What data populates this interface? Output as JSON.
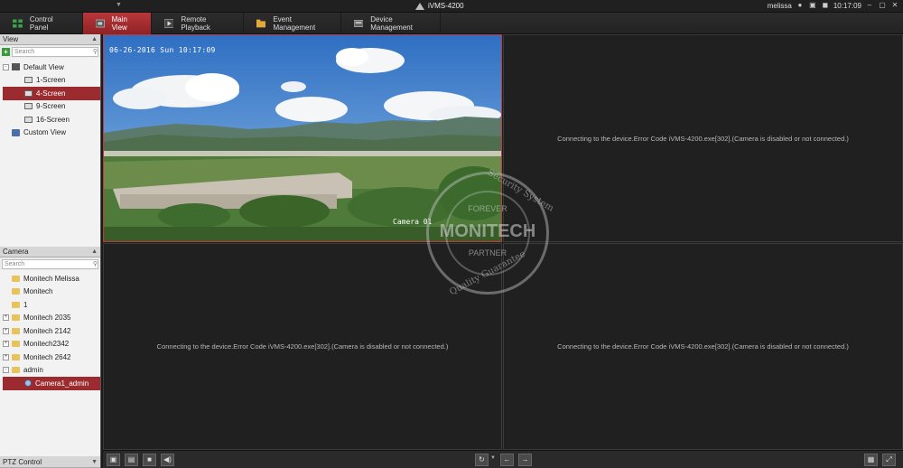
{
  "app": {
    "title": "iVMS-4200",
    "user": "melissa",
    "clock": "10:17:09"
  },
  "tabs": [
    {
      "label": "Control Panel",
      "icon": "grid-icon"
    },
    {
      "label": "Main View",
      "icon": "camera-view-icon",
      "active": true
    },
    {
      "label": "Remote Playback",
      "icon": "playback-icon"
    },
    {
      "label": "Event Management",
      "icon": "folder-event-icon"
    },
    {
      "label": "Device Management",
      "icon": "device-icon"
    }
  ],
  "view_panel": {
    "header": "View",
    "search_placeholder": "Search",
    "items": [
      {
        "label": "Default View"
      },
      {
        "label": "1-Screen"
      },
      {
        "label": "4-Screen"
      },
      {
        "label": "9-Screen"
      },
      {
        "label": "16-Screen"
      },
      {
        "label": "Custom View"
      }
    ]
  },
  "camera_panel": {
    "header": "Camera",
    "search_placeholder": "Search",
    "items": [
      {
        "label": "Monitech Melissa"
      },
      {
        "label": "Monitech"
      },
      {
        "label": "1"
      },
      {
        "label": "Monitech 2035"
      },
      {
        "label": "Monitech 2142"
      },
      {
        "label": "Monitech2342"
      },
      {
        "label": "Monitech 2642"
      },
      {
        "label": "admin"
      },
      {
        "label": "Camera1_admin"
      }
    ]
  },
  "ptz_panel": {
    "header": "PTZ Control"
  },
  "video": {
    "osd_time": "06-26-2016 Sun 10:17:09",
    "osd_camera": "Camera 01",
    "error_message": "Connecting to the device.Error Code iVMS-4200.exe[302].(Camera is disabled or not connected.)"
  },
  "watermark": {
    "top": "Security System",
    "forever": "FOREVER",
    "main": "MONITECH",
    "partner": "PARTNER",
    "bottom": "Quality Guarantee"
  },
  "colors": {
    "accent": "#9b2b2e",
    "active_tab": "#b8373b"
  }
}
